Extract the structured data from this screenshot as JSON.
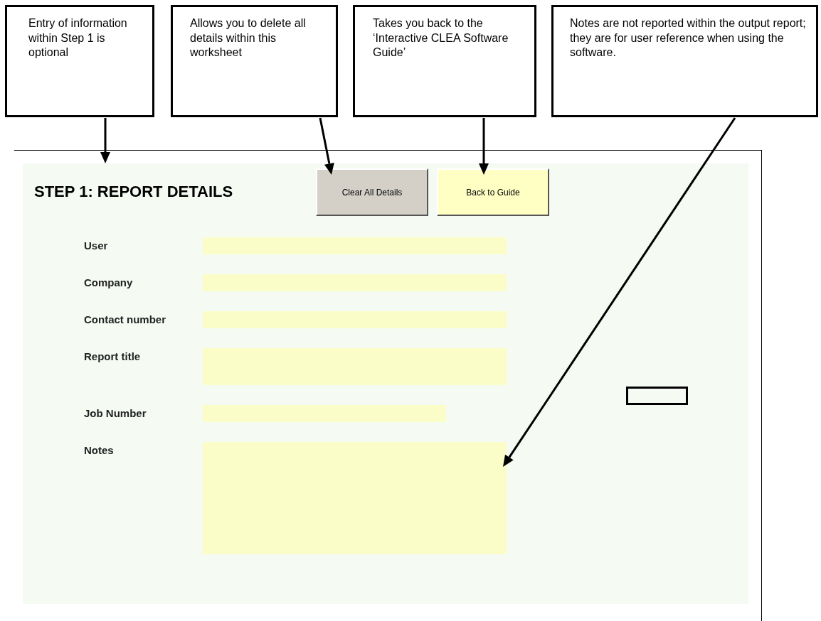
{
  "callouts": [
    {
      "text": "Entry of information within Step 1 is optional"
    },
    {
      "text": "Allows you to delete all details within this worksheet"
    },
    {
      "text": "Takes you back to the ‘Interactive CLEA Software Guide’"
    },
    {
      "text": "Notes are not reported within the output report; they are for user reference when using the software."
    }
  ],
  "sheet": {
    "heading": "STEP 1: REPORT DETAILS",
    "buttons": [
      {
        "label": "Clear All Details",
        "kind": "grey"
      },
      {
        "label": "Back to Guide",
        "kind": "yellow"
      }
    ],
    "fields": [
      {
        "label": "User",
        "kind": "line"
      },
      {
        "label": "Company",
        "kind": "line"
      },
      {
        "label": "Contact number",
        "kind": "line"
      },
      {
        "label": "Report title",
        "kind": "tall"
      },
      {
        "label": "Job Number",
        "kind": "short"
      },
      {
        "label": "Notes",
        "kind": "area"
      }
    ]
  }
}
